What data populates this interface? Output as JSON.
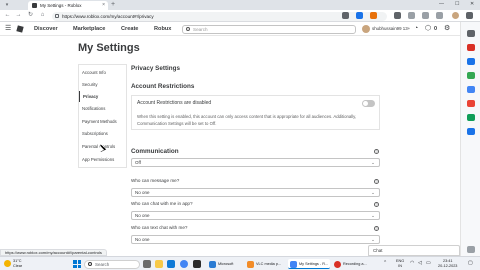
{
  "browser": {
    "tab_title": "My Settings - Roblox",
    "tab_close": "×",
    "new_tab": "+",
    "url": "https://www.roblox.com/my/account#!/privacy",
    "status_url": "https://www.roblox.com/my/account#!/parental-controls",
    "controls": {
      "minimize": "—",
      "maximize": "☐",
      "close": "✕"
    },
    "nav": {
      "back": "←",
      "forward": "→",
      "reload": "↻",
      "home": "⌂"
    }
  },
  "header": {
    "menu_icon": "☰",
    "nav": [
      "Discover",
      "Marketplace",
      "Create",
      "Robux"
    ],
    "search_placeholder": "Search",
    "username": "shubhussain99",
    "age_badge": "13+",
    "robux_count": "0",
    "colors": {
      "text": "#393b3d",
      "border": "#e6e6e6"
    }
  },
  "page": {
    "title": "My Settings",
    "nav_items": [
      "Account Info",
      "Security",
      "Privacy",
      "Notifications",
      "Payment Methods",
      "Subscriptions",
      "Parental Controls",
      "App Permissions"
    ],
    "active_item": "Privacy"
  },
  "privacy": {
    "heading": "Privacy Settings",
    "restrictions_heading": "Account Restrictions",
    "restrictions_label": "Account Restrictions are disabled",
    "restrictions_enabled": false,
    "restrictions_desc": "When this setting is enabled, this account can only access content that is appropriate for all audiences. Additionally, Communication Settings will be set to Off.",
    "communication_heading": "Communication",
    "communication_value": "Off",
    "questions": [
      {
        "label": "Who can message me?",
        "value": "No one"
      },
      {
        "label": "Who can chat with me in app?",
        "value": "No one"
      },
      {
        "label": "Who can text chat with me?",
        "value": "No one"
      }
    ],
    "info_glyph": "?",
    "chevron": "⌄"
  },
  "chat": {
    "label": "Chat"
  },
  "taskbar": {
    "weather_temp": "31°C",
    "weather_desc": "Clear",
    "search_placeholder": "Search",
    "windows": [
      {
        "label": "Microsoft",
        "color": "#2b7cd3"
      },
      {
        "label": "VLC media p...",
        "color": "#f28c28"
      },
      {
        "label": "My Settings - R...",
        "color": "#4285f4"
      },
      {
        "label": "Recording a...",
        "color": "#d93025"
      }
    ],
    "lang_top": "ENG",
    "lang_bottom": "IN",
    "time": "23:41",
    "date": "20-12-2023"
  }
}
